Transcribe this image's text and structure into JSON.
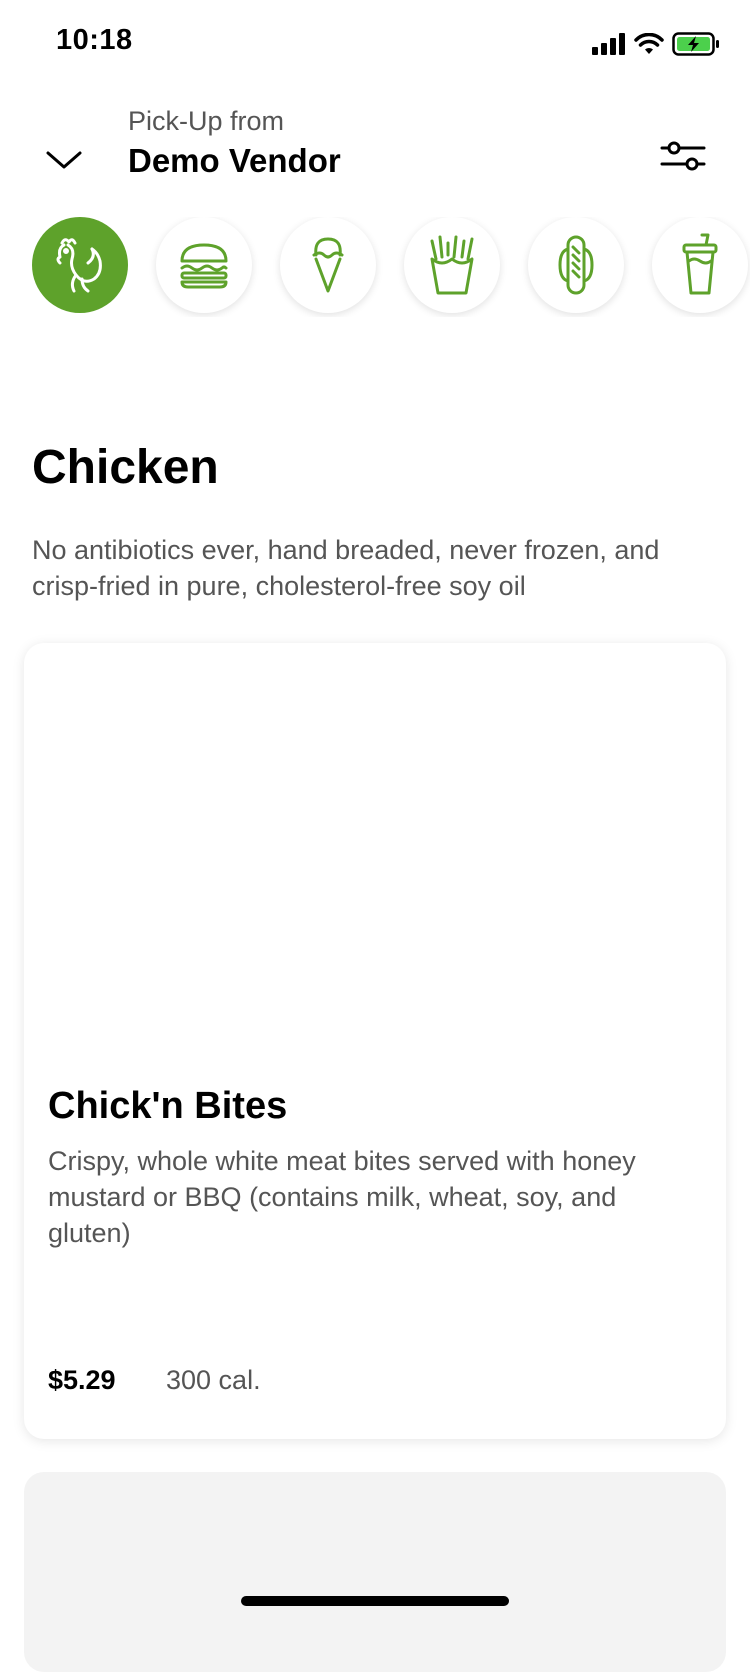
{
  "status_bar": {
    "time": "10:18"
  },
  "header": {
    "pickup_label": "Pick-Up from",
    "vendor": "Demo Vendor"
  },
  "categories": [
    {
      "icon": "chicken-icon",
      "active": true
    },
    {
      "icon": "burger-icon",
      "active": false
    },
    {
      "icon": "ice-cream-icon",
      "active": false
    },
    {
      "icon": "fries-icon",
      "active": false
    },
    {
      "icon": "hot-dog-icon",
      "active": false
    },
    {
      "icon": "drink-icon",
      "active": false
    }
  ],
  "section": {
    "title": "Chicken",
    "description": "No antibiotics ever, hand breaded, never frozen, and crisp-fried in pure, cholesterol-free soy oil"
  },
  "items": [
    {
      "name": "Chick'n Bites",
      "description": "Crispy, whole white meat bites served with honey mustard or BBQ (contains milk, wheat, soy, and gluten)",
      "price": "$5.29",
      "calories": "300 cal."
    }
  ],
  "colors": {
    "accent": "#5ea22b"
  }
}
